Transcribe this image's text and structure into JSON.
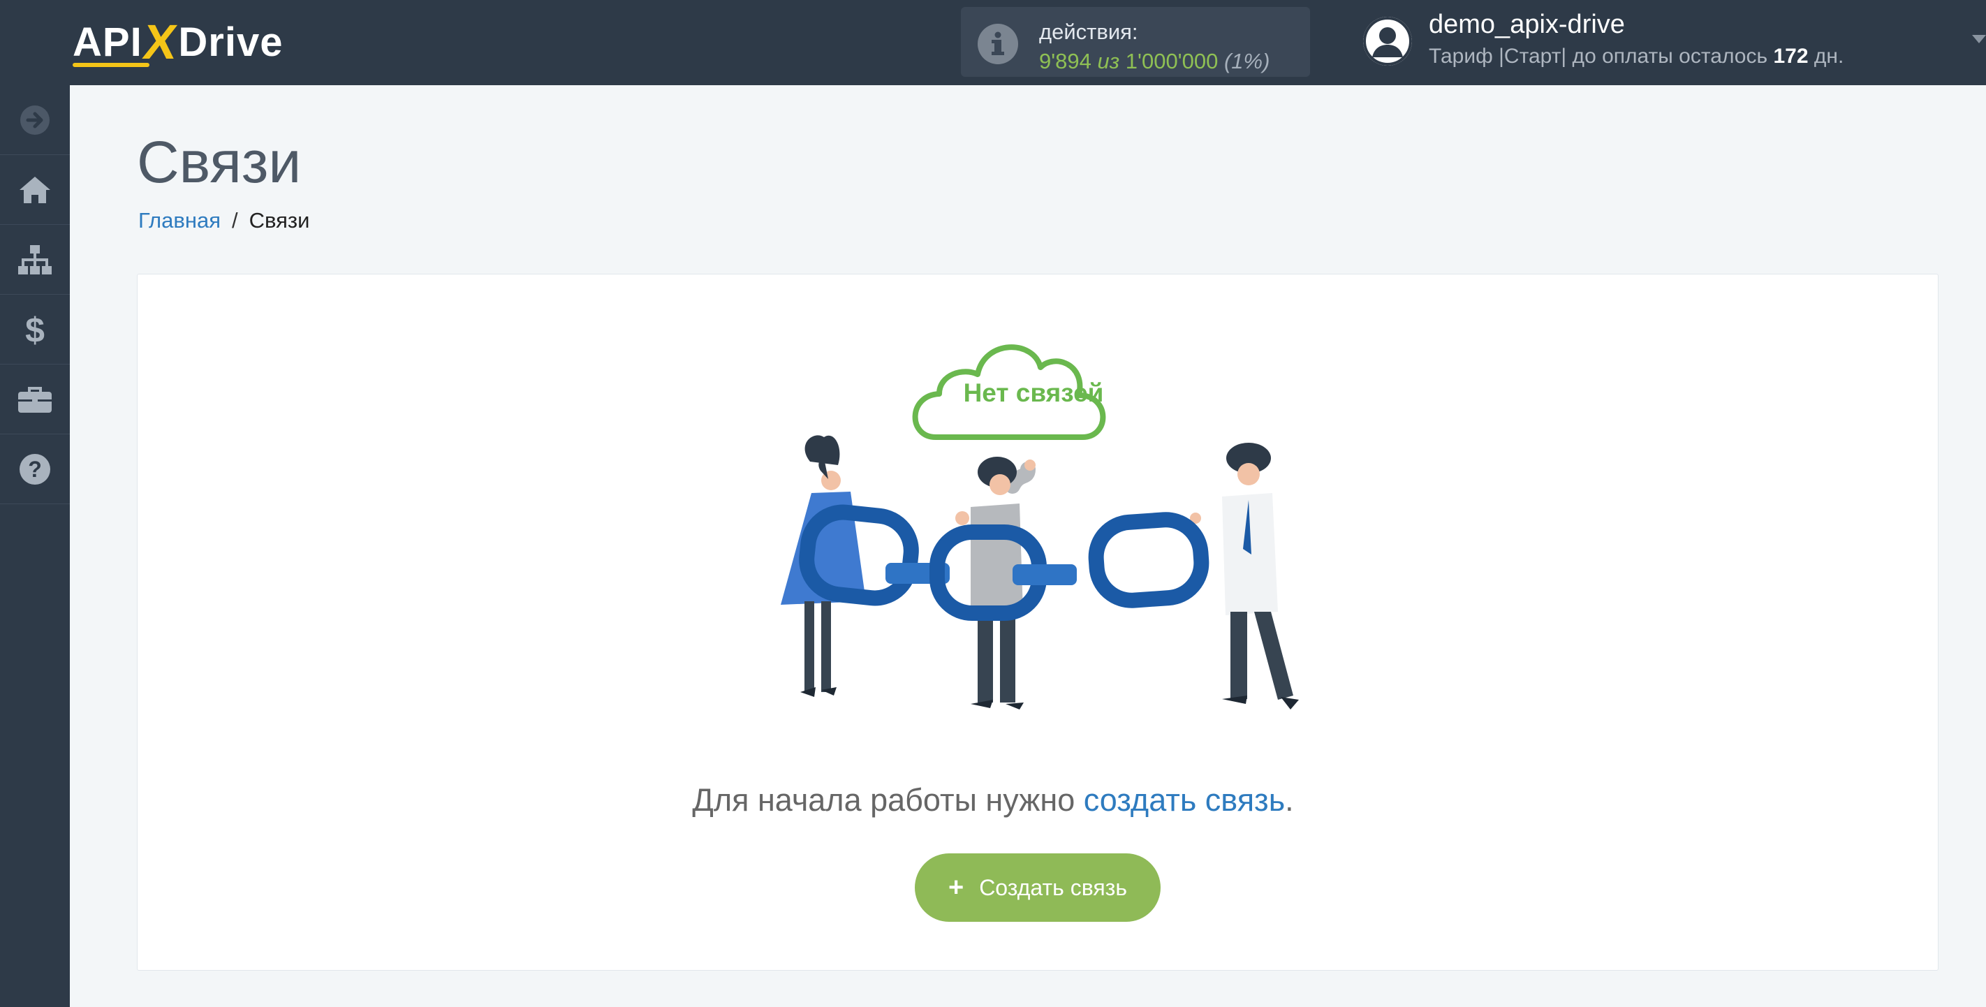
{
  "header": {
    "logo": {
      "api": "API",
      "x": "X",
      "drive": "Drive"
    },
    "actions": {
      "label": "действия:",
      "used": "9'894",
      "of": "из",
      "total": "1'000'000",
      "percent": "(1%)"
    },
    "user": {
      "name": "demo_apix-drive",
      "plan_prefix": "Тариф |Старт| до оплаты осталось",
      "days": "172",
      "days_suffix": "дн."
    }
  },
  "sidebar": {
    "items": [
      {
        "icon": "arrow-right-circle-icon"
      },
      {
        "icon": "home-icon"
      },
      {
        "icon": "sitemap-icon"
      },
      {
        "icon": "dollar-icon"
      },
      {
        "icon": "briefcase-icon"
      },
      {
        "icon": "question-circle-icon"
      }
    ]
  },
  "main": {
    "title": "Связи",
    "breadcrumb": {
      "home": "Главная",
      "separator": "/",
      "current": "Связи"
    },
    "empty_state": {
      "cloud_text": "Нет связей",
      "text_before": "Для начала работы нужно ",
      "link_text": "создать связь",
      "text_after": ".",
      "button_plus": "+",
      "button_label": "Создать связь"
    }
  },
  "colors": {
    "topbar": "#2e3a48",
    "accent_green": "#8fba57",
    "link_blue": "#2e7bbf",
    "logo_yellow": "#f5c518",
    "chain_blue": "#1b5aa6"
  }
}
